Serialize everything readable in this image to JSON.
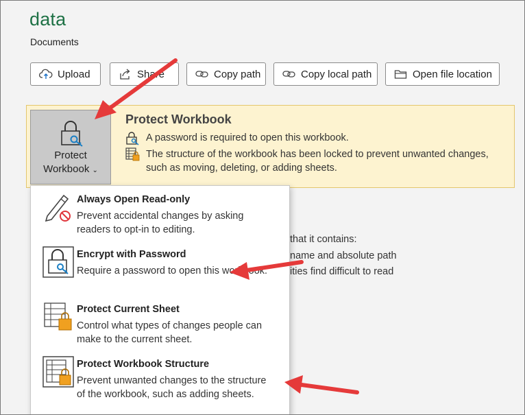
{
  "header": {
    "title": "data",
    "location": "Documents"
  },
  "toolbar": {
    "upload": "Upload",
    "share": "Share",
    "copy_path": "Copy path",
    "copy_local_path": "Copy local path",
    "open_file_location": "Open file location"
  },
  "protect": {
    "button_line1": "Protect",
    "button_line2": "Workbook",
    "heading": "Protect Workbook",
    "line1": "A password is required to open this workbook.",
    "line2a": "The structure of the workbook has been locked to prevent unwanted changes,",
    "line2b": "such as moving, deleting, or adding sheets."
  },
  "background_text": {
    "line1": "that it contains:",
    "line2": "name and absolute path",
    "line3": "ities find difficult to read"
  },
  "menu": {
    "items": [
      {
        "title": "Always Open Read-only",
        "desc": "Prevent accidental changes by asking readers to opt-in to editing."
      },
      {
        "title": "Encrypt with Password",
        "desc": "Require a password to open this workbook."
      },
      {
        "title": "Protect Current Sheet",
        "desc": "Control what types of changes people can make to the current sheet."
      },
      {
        "title": "Protect Workbook Structure",
        "desc": "Prevent unwanted changes to the structure of the workbook, such as adding sheets."
      }
    ]
  },
  "colors": {
    "title_green": "#1e7145",
    "panel_bg": "#fdf3d0",
    "arrow_red": "#e53a3a"
  }
}
